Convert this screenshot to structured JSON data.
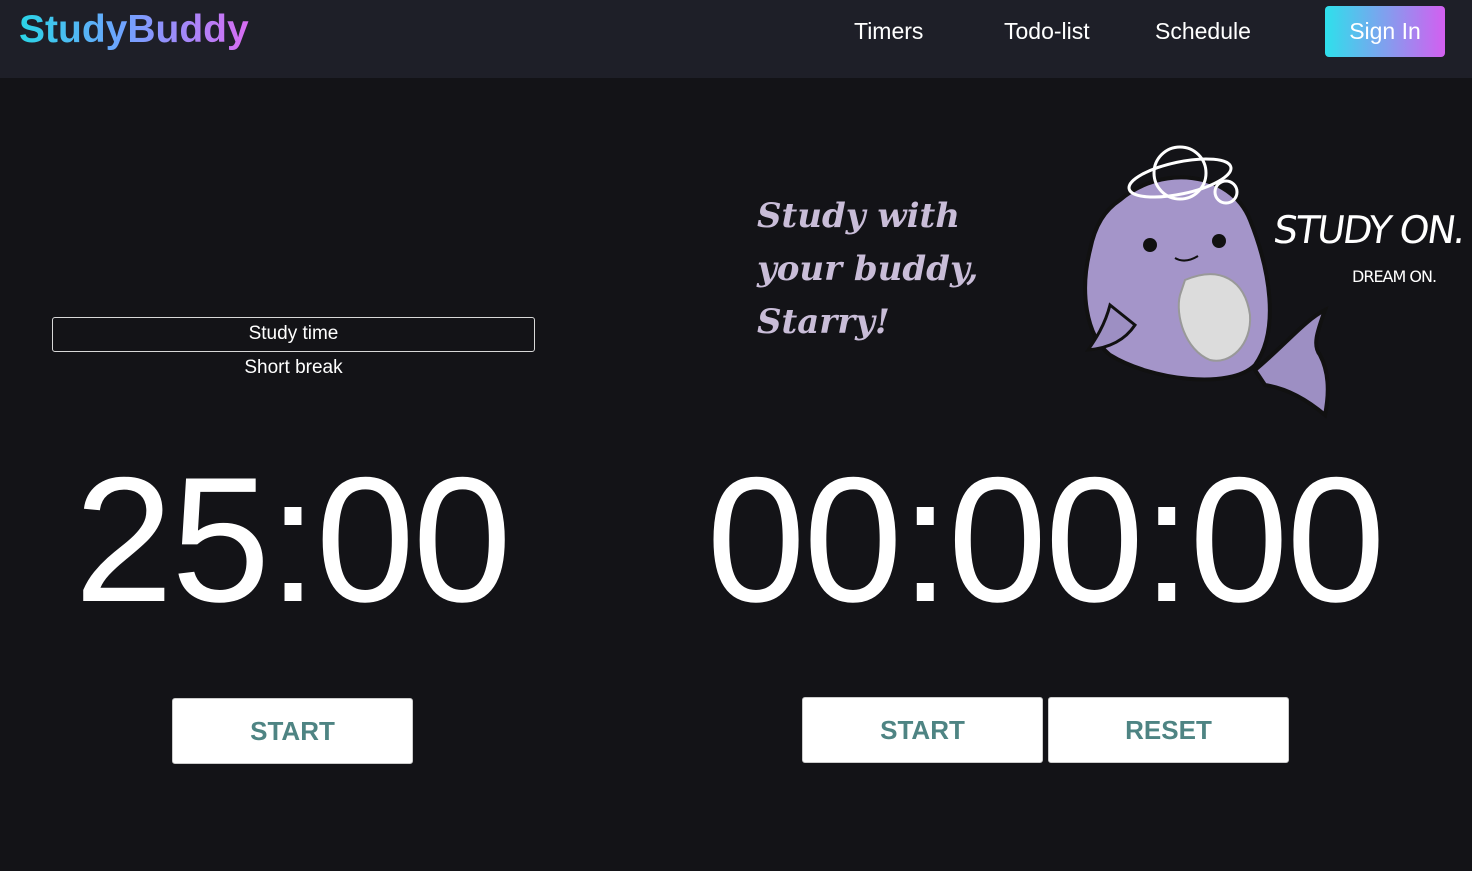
{
  "brand": {
    "name": "StudyBuddy"
  },
  "nav": {
    "links": [
      "Timers",
      "Todo-list",
      "Schedule"
    ],
    "signin_label": "Sign In"
  },
  "pomodoro": {
    "modes": [
      "Study time",
      "Short break"
    ],
    "selected_mode": "Study time",
    "display": "25:00",
    "start_label": "START"
  },
  "stopwatch": {
    "display": "00:00:00",
    "start_label": "START",
    "reset_label": "RESET"
  },
  "hero": {
    "tagline": "Study with\nyour buddy,\nStarry!",
    "illustration": "whale-mascot-with-planet",
    "illustration_text": [
      "STUDY ON.",
      "DREAM ON."
    ],
    "illustration_colors": {
      "body": "#9d8fc3",
      "belly": "#d9d9d9",
      "outline": "#111111"
    }
  },
  "colors": {
    "background": "#131317",
    "navbar": "#1e1f28",
    "button_text": "#4e8483",
    "brand_gradient": [
      "#2ad4e6",
      "#d96cf2"
    ]
  }
}
